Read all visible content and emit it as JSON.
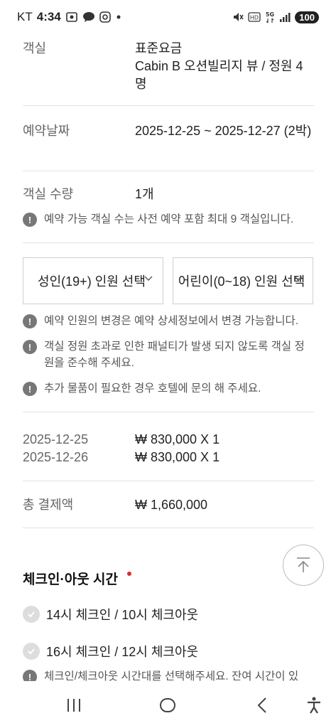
{
  "status_bar": {
    "carrier": "KT",
    "time": "4:34",
    "battery": "100",
    "icons": [
      "screenshot-icon",
      "talk-chat-icon",
      "instagram-icon",
      "dot-icon",
      "mute-icon",
      "hd-icon",
      "5g-icon",
      "signal-icon"
    ]
  },
  "room": {
    "label": "객실",
    "rate": "표준요금",
    "name": "Cabin B 오션빌리지 뷰 / 정원 4명"
  },
  "dates": {
    "label": "예약날짜",
    "value": "2025-12-25 ~ 2025-12-27 (2박)"
  },
  "quantity": {
    "label": "객실 수량",
    "value": "1개",
    "note": "예약 가능 객실 수는 사전 예약 포함 최대 9 객실입니다."
  },
  "guests": {
    "adult_select": "성인(19+) 인원 선택",
    "child_select": "어린이(0~18) 인원 선택",
    "notes": [
      "예약 인원의 변경은 예약 상세정보에서 변경 가능합니다.",
      "객실 정원 초과로 인한 패널티가 발생 되지 않도록 객실 정원을 준수해 주세요.",
      "추가 물품이 필요한 경우 호텔에 문의 해 주세요."
    ]
  },
  "prices": [
    {
      "date": "2025-12-25",
      "amount": "₩ 830,000 X 1"
    },
    {
      "date": "2025-12-26",
      "amount": "₩ 830,000 X 1"
    }
  ],
  "total": {
    "label": "총 결제액",
    "value": "₩ 1,660,000"
  },
  "checkin": {
    "title": "체크인·아웃 시간",
    "options": [
      "14시 체크인 / 10시 체크아웃",
      "16시 체크인 / 12시 체크아웃"
    ],
    "note": "체크인/체크아웃 시간대를 선택해주세요. 잔여 시간이 있"
  },
  "colors": {
    "required": "#e02b2b",
    "divider": "#e2e2e2",
    "label": "#666666"
  }
}
